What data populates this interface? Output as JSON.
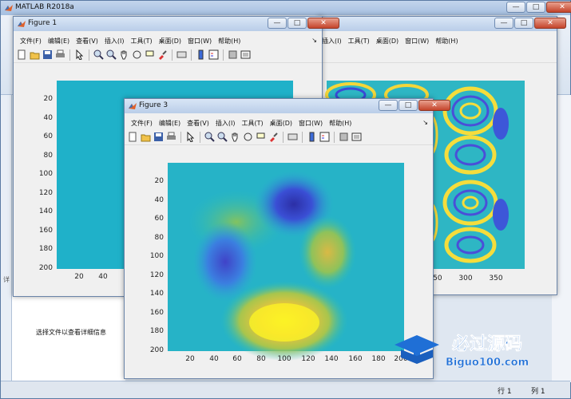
{
  "matlab": {
    "title": "MATLAB R2018a",
    "side_label": "详",
    "detail_text": "选择文件以查看详细信息",
    "status": {
      "row_label": "行",
      "row_value": "1",
      "col_label": "列",
      "col_value": "1"
    }
  },
  "menus": [
    "文件(F)",
    "编辑(E)",
    "查看(V)",
    "插入(I)",
    "工具(T)",
    "桌面(D)",
    "窗口(W)",
    "帮助(H)"
  ],
  "window_buttons": {
    "minimize": "—",
    "maximize": "□",
    "close": "✕"
  },
  "figures": {
    "figure1": {
      "title": "Figure 1",
      "y_ticks": [
        "20",
        "40",
        "60",
        "80",
        "100",
        "120",
        "140",
        "160",
        "180",
        "200"
      ],
      "x_ticks": [
        "20",
        "40"
      ],
      "colors": {
        "field": "#1fb1c9"
      }
    },
    "figure2": {
      "x_ticks": [
        "250",
        "300",
        "350"
      ]
    },
    "figure3": {
      "title": "Figure 3",
      "y_ticks": [
        "20",
        "40",
        "60",
        "80",
        "100",
        "120",
        "140",
        "160",
        "180",
        "200"
      ],
      "x_ticks": [
        "20",
        "40",
        "60",
        "80",
        "100",
        "120",
        "140",
        "160",
        "180",
        "200"
      ],
      "colormap": "parula"
    }
  },
  "watermark": {
    "brand": "必过源码",
    "url": "Biguo100.com"
  },
  "icons": [
    "new-file-icon",
    "open-icon",
    "save-icon",
    "print-icon",
    "pointer-icon",
    "zoom-in-icon",
    "zoom-out-icon",
    "pan-icon",
    "rotate-icon",
    "data-cursor-icon",
    "brush-icon",
    "link-icon",
    "colorbar-icon",
    "legend-icon",
    "hide-tools-icon",
    "dock-icon"
  ]
}
